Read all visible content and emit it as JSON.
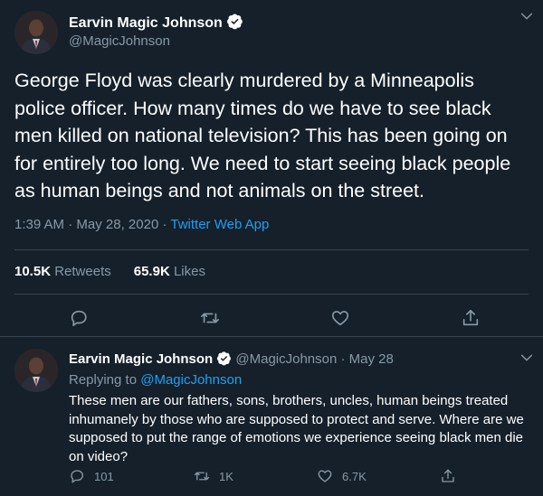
{
  "main_tweet": {
    "display_name": "Earvin Magic Johnson",
    "handle": "@MagicJohnson",
    "text": "George Floyd was clearly murdered by a Minneapolis police officer. How many times do we have to see black men killed on national television? This has been going on for entirely too long. We need to start seeing black people as human beings and not animals on the street.",
    "time": "1:39 AM",
    "date": "May 28, 2020",
    "source": "Twitter Web App",
    "retweets_count": "10.5K",
    "retweets_label": "Retweets",
    "likes_count": "65.9K",
    "likes_label": "Likes",
    "separator": "·"
  },
  "reply_tweet": {
    "display_name": "Earvin Magic Johnson",
    "handle": "@MagicJohnson",
    "date": "May 28",
    "separator": "·",
    "replying_to_label": "Replying to",
    "replying_to_handle": "@MagicJohnson",
    "text": "These men are our fathers, sons, brothers, uncles, human beings treated inhumanely by those who are supposed to protect and serve. Where are we supposed to put the range of emotions we experience seeing black men die on video?",
    "reply_count": "101",
    "retweet_count": "1K",
    "like_count": "6.7K"
  },
  "icons": [
    "verified-badge-icon",
    "chevron-down-icon",
    "reply-icon",
    "retweet-icon",
    "like-icon",
    "share-icon"
  ],
  "colors": {
    "background": "#15202b",
    "text": "#ffffff",
    "secondary_text": "#8899a6",
    "link": "#1da1f2",
    "divider": "#38444d"
  }
}
